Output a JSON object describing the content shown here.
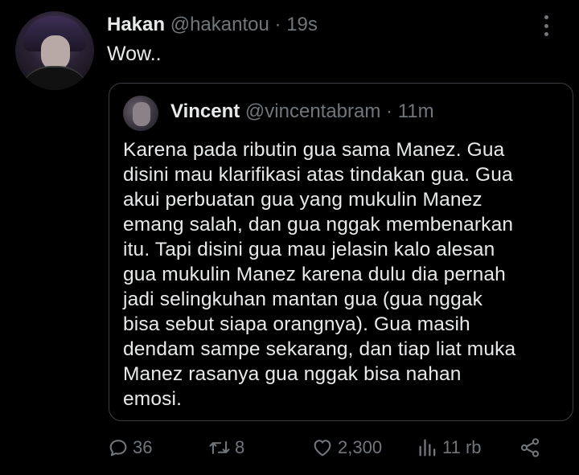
{
  "tweet": {
    "name": "Hakan",
    "handle": "@hakantou",
    "separator": "·",
    "time": "19s",
    "text": "Wow.."
  },
  "quote": {
    "name": "Vincent",
    "handle": "@vincentabram",
    "separator": "·",
    "time": "11m",
    "lines": [
      "Karena pada ributin gua sama Manez. Gua",
      "disini mau klarifikasi atas tindakan gua. Gua",
      "akui perbuatan gua yang mukulin Manez",
      "emang salah, dan gua nggak membenarkan",
      "itu. Tapi disini gua mau jelasin kalo alesan",
      "gua mukulin Manez karena dulu dia pernah",
      "jadi selingkuhan mantan gua (gua nggak",
      "bisa sebut siapa orangnya). Gua masih",
      "dendam sampe sekarang, dan tiap liat muka",
      "Manez rasanya gua nggak bisa nahan",
      "emosi."
    ]
  },
  "actions": {
    "replies": "36",
    "retweets": "8",
    "likes": "2,300",
    "views": "11 rb"
  },
  "icons": {
    "reply": "reply-icon",
    "retweet": "retweet-icon",
    "like": "heart-icon",
    "views": "views-icon",
    "share": "share-icon",
    "more": "more-vertical-icon"
  },
  "colors": {
    "background": "#000000",
    "text": "#e7e9ea",
    "muted": "#71767b",
    "border": "#3a3f44"
  }
}
